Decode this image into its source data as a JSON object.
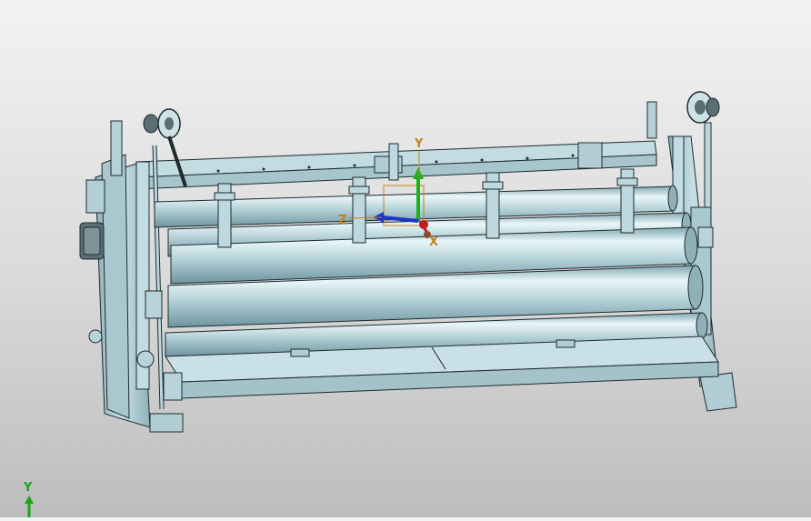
{
  "viewport": {
    "background_top": "#f3f3f3",
    "background_bottom": "#bdbdbd",
    "model_color": "#b9d6dc",
    "edge_color": "#1f2a2e"
  },
  "triad": {
    "x_label": "X",
    "y_label": "Y",
    "z_label": "Z",
    "x_color": "#c01c1c",
    "y_color": "#19b319",
    "z_color": "#1c36c9",
    "label_color": "#c8801a"
  },
  "corner_triad": {
    "y_label": "Y",
    "y_color": "#1aa51a"
  }
}
